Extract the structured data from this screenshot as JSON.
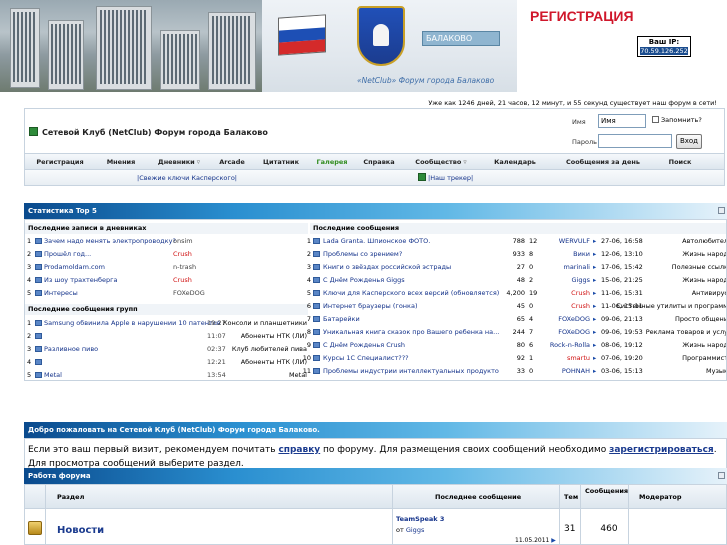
{
  "header": {
    "registration_title": "РЕГИСТРАЦИЯ",
    "ip_label": "Ваш IP:",
    "ip_value": "70.59.126.252",
    "banner_caption": "«NetClub» Форум города Балаково",
    "emblem_text": "БАЛАКОВО"
  },
  "uptime": "Уже как 1246 дней, 21 часов, 12 минут, и 55 секунд существует наш форум в сети!",
  "forum_title": "Сетевой Клуб (NetClub) Форум города Балаково",
  "login": {
    "name_label": "Имя",
    "name_value": "Имя",
    "password_label": "Пароль",
    "remember_label": "Запомнить?",
    "submit_label": "Вход"
  },
  "nav": [
    {
      "label": "Регистрация",
      "dropdown": false,
      "active": false
    },
    {
      "label": "Мнения",
      "dropdown": false,
      "active": false
    },
    {
      "label": "Дневники",
      "dropdown": true,
      "active": false
    },
    {
      "label": "Arcade",
      "dropdown": false,
      "active": false
    },
    {
      "label": "Цитатник",
      "dropdown": false,
      "active": false
    },
    {
      "label": "Галерея",
      "dropdown": false,
      "active": true
    },
    {
      "label": "Справка",
      "dropdown": false,
      "active": false
    },
    {
      "label": "Сообщество",
      "dropdown": true,
      "active": false
    },
    {
      "label": "Календарь",
      "dropdown": false,
      "active": false
    },
    {
      "label": "Сообщения за день",
      "dropdown": false,
      "active": false
    },
    {
      "label": "Поиск",
      "dropdown": false,
      "active": false
    }
  ],
  "extra_links": {
    "kaspersky": "|Свежие ключи Касперского|",
    "tracker": "|Наш трекер|"
  },
  "stats": {
    "title": "Статистика Top 5",
    "diary_header": "Последние записи в дневниках",
    "diary": [
      {
        "n": "1",
        "title": "Зачем надо менять электропроводку?",
        "user": "onsim",
        "user_color": "#444444"
      },
      {
        "n": "2",
        "title": "Прошёл год...",
        "user": "Crush",
        "user_color": "#d01010"
      },
      {
        "n": "3",
        "title": "Prodamoldam.com",
        "user": "n-trash",
        "user_color": "#444444"
      },
      {
        "n": "4",
        "title": "Из шоу трахтенберга",
        "user": "Crush",
        "user_color": "#d01010"
      },
      {
        "n": "5",
        "title": "Интересы",
        "user": "FOXeDOG",
        "user_color": "#444444"
      }
    ],
    "groups_header": "Последние сообщения групп",
    "groups": [
      {
        "n": "1",
        "title": "Samsung обвинила Apple в нарушении 10 патентов",
        "time": "19:27",
        "group": "Консоли и планшетники"
      },
      {
        "n": "2",
        "title": "",
        "time": "11:07",
        "group": "Абоненты НТК (ЛИ)"
      },
      {
        "n": "3",
        "title": "Разливное пиво",
        "time": "02:37",
        "group": "Клуб любителей пива"
      },
      {
        "n": "4",
        "title": "",
        "time": "12:21",
        "group": "Абоненты НТК (ЛИ)"
      },
      {
        "n": "5",
        "title": "Metal",
        "time": "13:54",
        "group": "Metal"
      }
    ],
    "posts_header": "Последние сообщения",
    "posts": [
      {
        "n": "1",
        "title": "Lada Granta. Шпионское ФОТО.",
        "views": "788",
        "replies": "12",
        "user": "WERVULF",
        "user_color": "#13328a",
        "date": "27-06, 16:58",
        "forum": "Автолюбител"
      },
      {
        "n": "2",
        "title": "Проблемы со зрением?",
        "views": "933",
        "replies": "8",
        "user": "Вики",
        "user_color": "#13328a",
        "date": "12-06, 13:10",
        "forum": "Жизнь народ"
      },
      {
        "n": "3",
        "title": "Книги о звёздах российской эстрады",
        "views": "27",
        "replies": "0",
        "user": "marinali",
        "user_color": "#13328a",
        "date": "17-06, 15:42",
        "forum": "Полезные ссылк"
      },
      {
        "n": "4",
        "title": "С Днём Рожденья Giggs",
        "views": "48",
        "replies": "2",
        "user": "Giggs",
        "user_color": "#13328a",
        "date": "15-06, 21:25",
        "forum": "Жизнь народ"
      },
      {
        "n": "5",
        "title": "Ключи для Касперского всех версий (обновляется)",
        "views": "4,200",
        "replies": "19",
        "user": "Crush",
        "user_color": "#d01010",
        "date": "11-06, 15:31",
        "forum": "Антивирус"
      },
      {
        "n": "6",
        "title": "Интернет браузеры (гонка)",
        "views": "45",
        "replies": "0",
        "user": "Crush",
        "user_color": "#d01010",
        "date": "11-06, 15:11",
        "forum": "Системные утилиты и программ"
      },
      {
        "n": "7",
        "title": "Батарейки",
        "views": "65",
        "replies": "4",
        "user": "FOXeDOG",
        "user_color": "#13328a",
        "date": "09-06, 21:13",
        "forum": "Просто общени"
      },
      {
        "n": "8",
        "title": "Уникальная книга сказок про Вашего ребенка на...",
        "views": "244",
        "replies": "7",
        "user": "FOXeDOG",
        "user_color": "#13328a",
        "date": "09-06, 19:53",
        "forum": "Реклама товаров и услу"
      },
      {
        "n": "9",
        "title": "С Днём Рожденья Crush",
        "views": "80",
        "replies": "6",
        "user": "Rock-n-Rolla",
        "user_color": "#13328a",
        "date": "08-06, 19:12",
        "forum": "Жизнь народ"
      },
      {
        "n": "10",
        "title": "Курсы 1С Специалист???",
        "views": "92",
        "replies": "1",
        "user": "smartu",
        "user_color": "#d01010",
        "date": "07-06, 19:20",
        "forum": "Программист"
      },
      {
        "n": "11",
        "title": "Проблемы индустрии интеллектуальных продуктов",
        "views": "33",
        "replies": "0",
        "user": "POHNAH",
        "user_color": "#13328a",
        "date": "03-06, 15:13",
        "forum": "Музык"
      }
    ]
  },
  "welcome": {
    "title": "Добро пожаловать на Сетевой Клуб (NetClub) Форум города Балаково.",
    "text1": "Если это ваш первый визит, рекомендуем почитать ",
    "link1": "справку",
    "text2": " по форуму. Для размещения своих сообщений необходимо ",
    "link2": "зарегистрироваться",
    "text3": ". Для просмотра сообщений выберите раздел."
  },
  "forum_work": {
    "title": "Работа форума",
    "col_section": "Раздел",
    "col_last": "Последнее сообщение",
    "col_topics": "Тем",
    "col_posts": "Сообщения",
    "col_moderator": "Модератор",
    "rows": [
      {
        "name": "Новости",
        "last_topic": "TeamSpeak 3",
        "last_by_prefix": "от ",
        "last_by": "Giggs",
        "last_date": "11.05.2011",
        "topics": "31",
        "posts": "460"
      }
    ]
  },
  "colors": {
    "accent_red": "#d01010",
    "link_blue": "#13328a",
    "bar_dark": "#0a4a8d",
    "nav_active_green": "#2f8b1d"
  }
}
